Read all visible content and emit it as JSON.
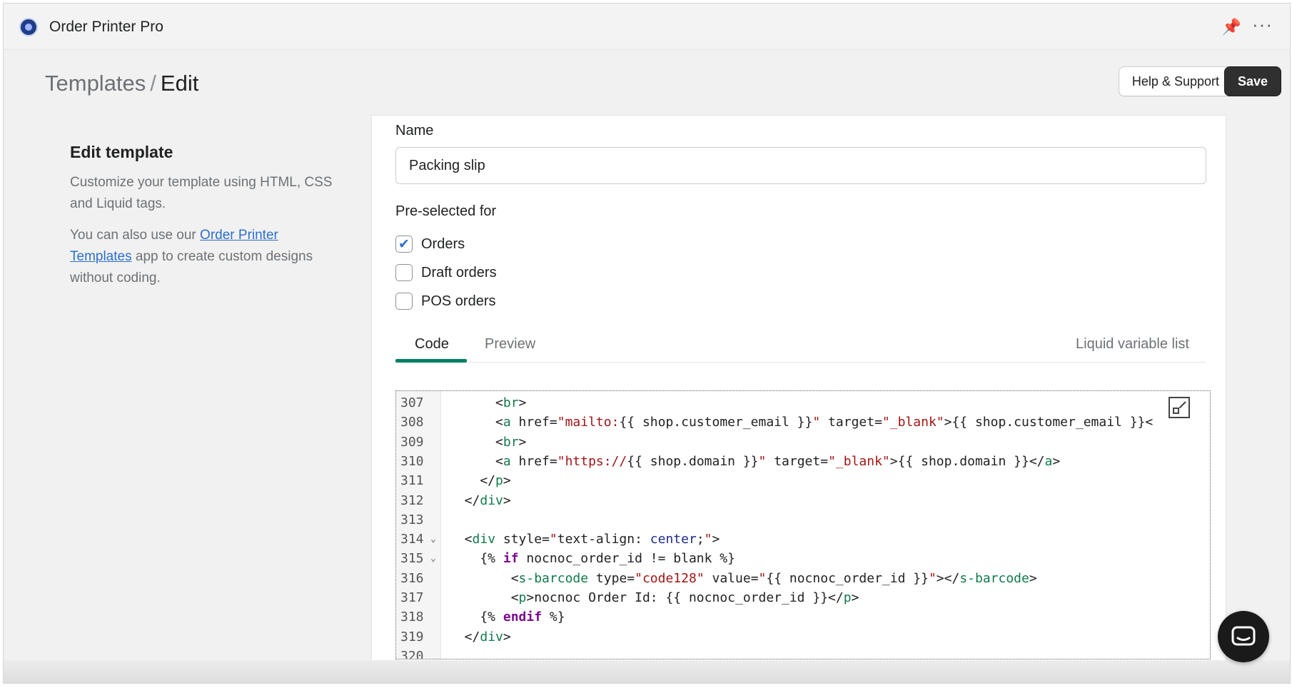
{
  "app": {
    "title": "Order Printer Pro",
    "pin_icon": "pin-icon",
    "more_icon": "more-dots-icon"
  },
  "breadcrumb": {
    "parent": "Templates",
    "separator": "/",
    "current": "Edit"
  },
  "actions": {
    "help_label": "Help & Support",
    "save_label": "Save"
  },
  "sidebar": {
    "heading": "Edit template",
    "description": "Customize your template using HTML, CSS and Liquid tags.",
    "link_prefix": "You can also use our ",
    "link_text": "Order Printer Templates",
    "link_suffix": " app to create custom designs without coding."
  },
  "form": {
    "name_label": "Name",
    "name_value": "Packing slip",
    "preselected_label": "Pre-selected for",
    "options": [
      {
        "label": "Orders",
        "checked": true
      },
      {
        "label": "Draft orders",
        "checked": false
      },
      {
        "label": "POS orders",
        "checked": false
      }
    ]
  },
  "tabs": {
    "code": "Code",
    "preview": "Preview",
    "liquid": "Liquid variable list",
    "active": "Code"
  },
  "editor": {
    "lines": [
      {
        "n": "307",
        "html": "      &lt;<span class=\"t\">br</span>&gt;"
      },
      {
        "n": "308",
        "html": "      &lt;<span class=\"t\">a</span> href=<span class=\"s\">\"mailto:</span>{{ shop.customer_email }}<span class=\"s\">\"</span> target=<span class=\"s\">\"_blank\"</span>&gt;{{ shop.customer_email }}&lt;"
      },
      {
        "n": "309",
        "html": "      &lt;<span class=\"t\">br</span>&gt;"
      },
      {
        "n": "310",
        "html": "      &lt;<span class=\"t\">a</span> href=<span class=\"s\">\"https://</span>{{ shop.domain }}<span class=\"s\">\"</span> target=<span class=\"s\">\"_blank\"</span>&gt;{{ shop.domain }}&lt;/<span class=\"t\">a</span>&gt;"
      },
      {
        "n": "311",
        "html": "    &lt;/<span class=\"t\">p</span>&gt;"
      },
      {
        "n": "312",
        "html": "  &lt;/<span class=\"t\">div</span>&gt;"
      },
      {
        "n": "313",
        "html": ""
      },
      {
        "n": "314",
        "fold": true,
        "html": "  &lt;<span class=\"t\">div</span> style=<span class=\"s\">\"</span>text-align: <span class=\"v\">center</span>;<span class=\"s\">\"</span>&gt;"
      },
      {
        "n": "315",
        "fold": true,
        "html": "    {% <span class=\"k\">if</span> nocnoc_order_id != blank %}"
      },
      {
        "n": "316",
        "html": "        &lt;<span class=\"t\">s-barcode</span> type=<span class=\"s\">\"code128\"</span> value=<span class=\"s\">\"</span>{{ nocnoc_order_id }}<span class=\"s\">\"</span>&gt;&lt;/<span class=\"t\">s-barcode</span>&gt;"
      },
      {
        "n": "317",
        "html": "        &lt;<span class=\"t\">p</span>&gt;nocnoc Order Id: {{ nocnoc_order_id }}&lt;/<span class=\"t\">p</span>&gt;"
      },
      {
        "n": "318",
        "html": "    {% <span class=\"k\">endif</span> %}"
      },
      {
        "n": "319",
        "html": "  &lt;/<span class=\"t\">div</span>&gt;"
      },
      {
        "n": "320",
        "html": ""
      }
    ]
  },
  "colors": {
    "accent": "#008060",
    "primary_button": "#303030",
    "link": "#2c6ecb"
  }
}
